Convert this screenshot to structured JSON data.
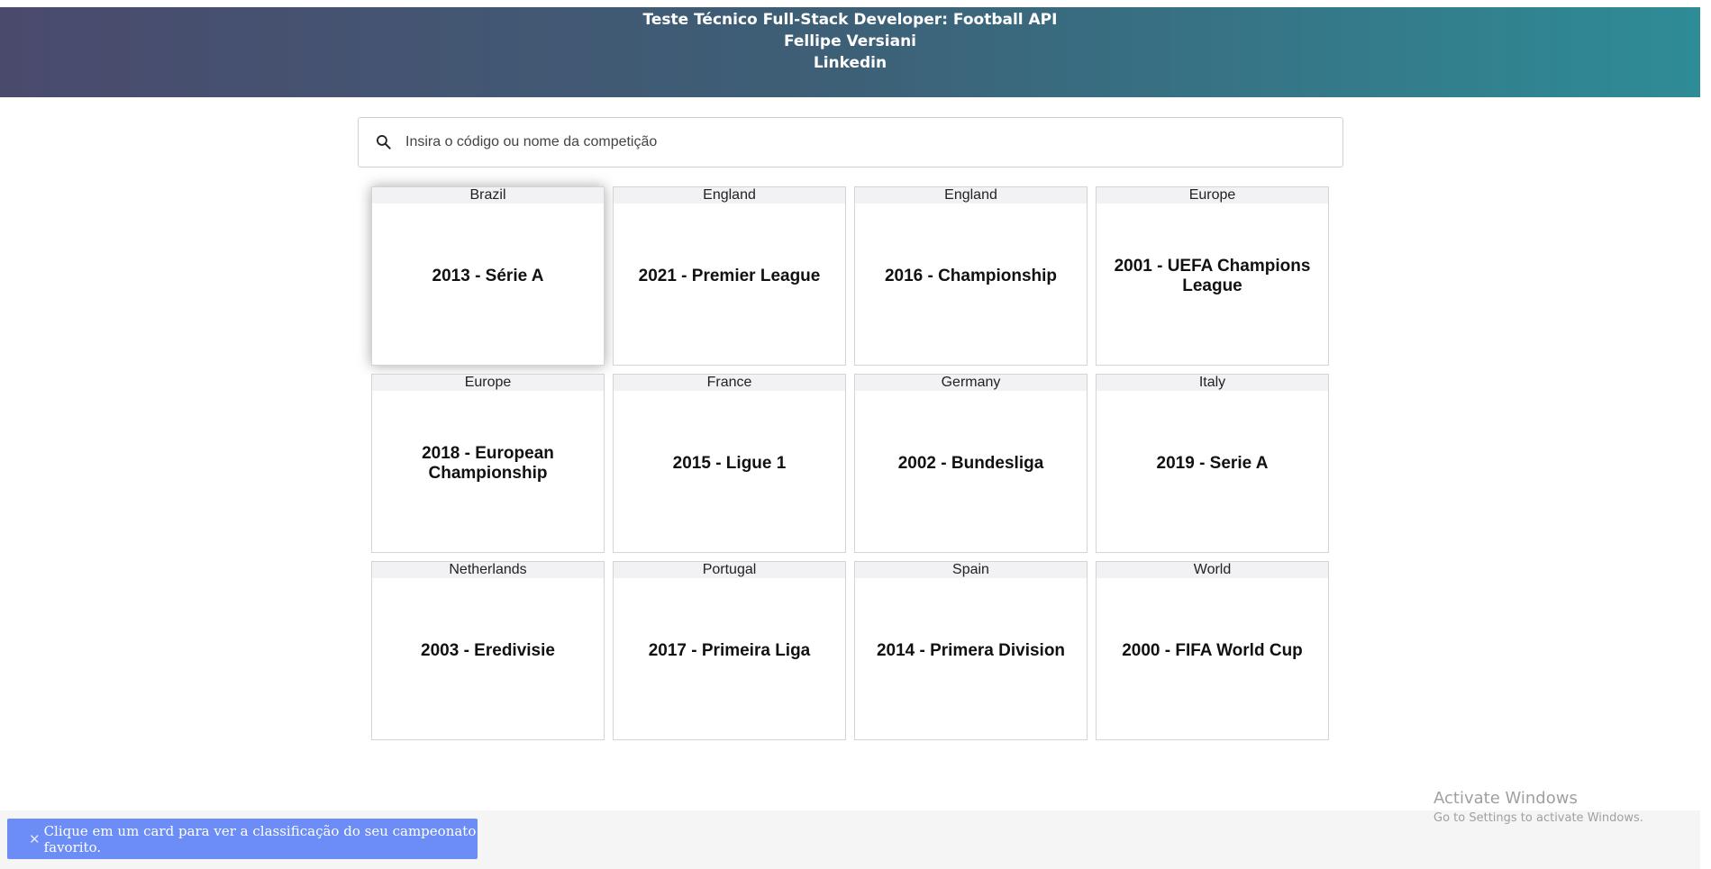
{
  "header": {
    "title": "Teste Técnico Full-Stack Developer: Football API",
    "author": "Fellipe Versiani",
    "link_label": "Linkedin"
  },
  "search": {
    "icon": "search-icon",
    "placeholder": "Insira o código ou nome da competição",
    "value": ""
  },
  "competitions": [
    {
      "area": "Brazil",
      "title": "2013 - Série A"
    },
    {
      "area": "England",
      "title": "2021 - Premier League"
    },
    {
      "area": "England",
      "title": "2016 - Championship"
    },
    {
      "area": "Europe",
      "title": "2001 - UEFA Champions League"
    },
    {
      "area": "Europe",
      "title": "2018 - European Championship"
    },
    {
      "area": "France",
      "title": "2015 - Ligue 1"
    },
    {
      "area": "Germany",
      "title": "2002 - Bundesliga"
    },
    {
      "area": "Italy",
      "title": "2019 - Serie A"
    },
    {
      "area": "Netherlands",
      "title": "2003 - Eredivisie"
    },
    {
      "area": "Portugal",
      "title": "2017 - Primeira Liga"
    },
    {
      "area": "Spain",
      "title": "2014 - Primera Division"
    },
    {
      "area": "World",
      "title": "2000 - FIFA World Cup"
    }
  ],
  "toast": {
    "close_icon": "close-icon",
    "message": "Clique em um card para ver a classificação do seu campeonato favorito."
  },
  "watermark": {
    "title": "Activate Windows",
    "subtitle": "Go to Settings to activate Windows."
  },
  "colors": {
    "header_start": "#4a4a6d",
    "header_end": "#2e8c97",
    "toast_bg": "#6b8df5"
  }
}
